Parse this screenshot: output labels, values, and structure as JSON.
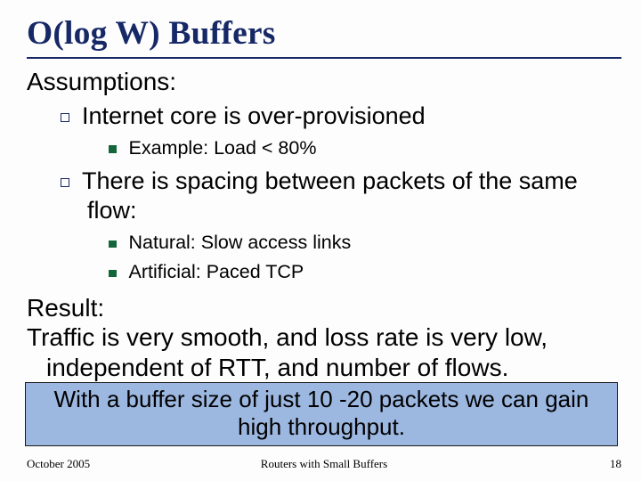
{
  "title": "O(log W) Buffers",
  "sections": {
    "assumptions_label": "Assumptions:",
    "result_label": "Result:",
    "result_text": "Traffic is very smooth, and loss rate is very low, independent of RTT, and number of flows."
  },
  "bullets": {
    "a1": "Internet core is over-provisioned",
    "a1_1": "Example: Load < 80%",
    "a2": "There is spacing between packets of the same flow:",
    "a2_1": "Natural: Slow access links",
    "a2_2": "Artificial: Paced TCP"
  },
  "callout": "With a buffer size of just 10 -20 packets we can gain high throughput.",
  "footer": {
    "left": "October 2005",
    "center": "Routers with Small Buffers",
    "right": "18"
  }
}
